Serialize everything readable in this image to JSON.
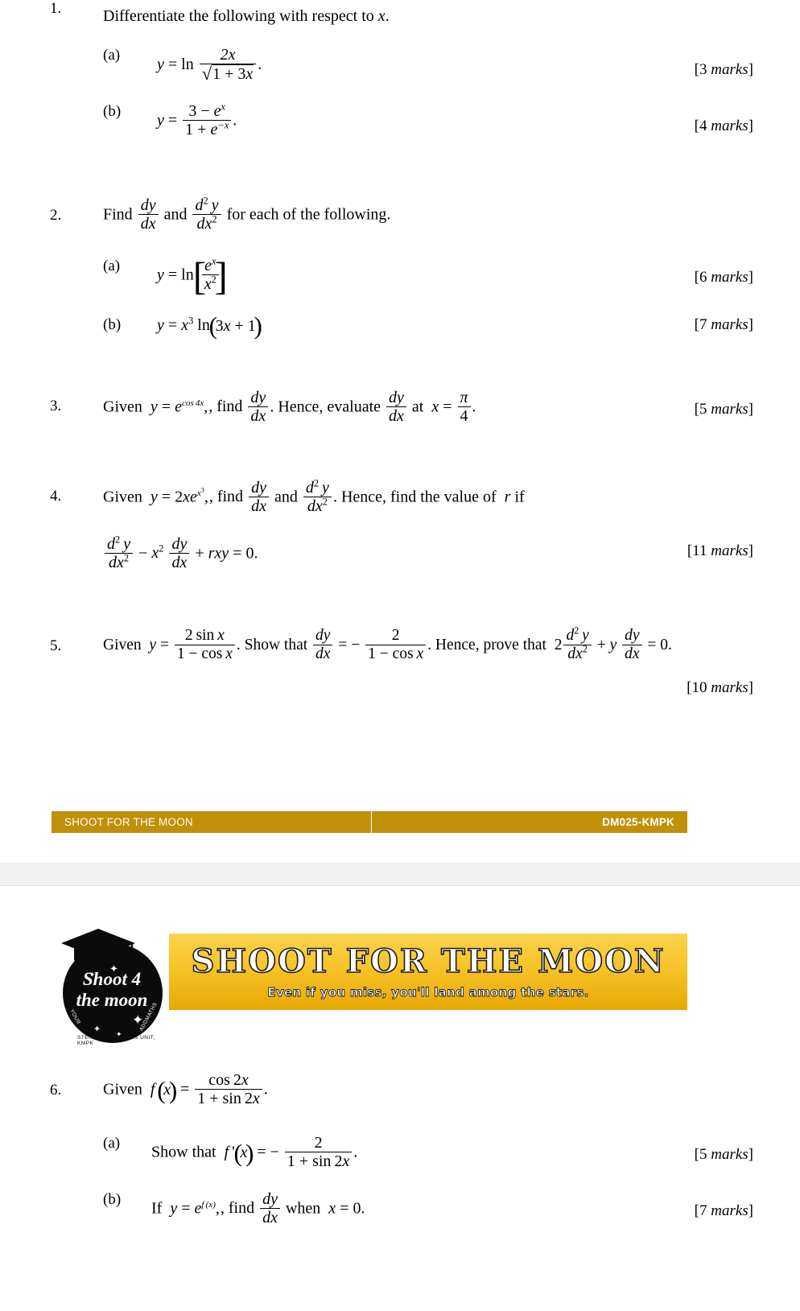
{
  "document": {
    "title": "SHOOT FOR THE MOON",
    "paper_code": "DM025-KMPK",
    "accent_color": "#c0900a",
    "banner_gradient_top": "#fbd24e",
    "banner_gradient_bottom": "#e6a804"
  },
  "questions": {
    "q1": {
      "number": "1.",
      "stem": "Differentiate the following with respect to",
      "stem_var": "x",
      "stem_end": ".",
      "a": {
        "label": "(a)",
        "lhs": "y",
        "eq": "=",
        "fn": "ln",
        "numerator": "2x",
        "denominator": "1 + 3x",
        "period": ".",
        "marks": "[3 marks]",
        "marks_count": "3",
        "marks_word": "marks"
      },
      "b": {
        "label": "(b)",
        "lhs": "y",
        "eq": "=",
        "numerator": "3 − e^x",
        "denominator": "1 + e^-x",
        "period": ".",
        "marks": "[4 marks]",
        "marks_count": "4",
        "marks_word": "marks"
      }
    },
    "q2": {
      "number": "2.",
      "stem_pre": "Find",
      "stem_mid": "and",
      "stem_post": "for each of the following.",
      "a": {
        "label": "(a)",
        "lhs": "y",
        "eq": "=",
        "fn": "ln",
        "numerator": "e^x",
        "denominator": "x^2",
        "marks": "[6 marks]",
        "marks_count": "6",
        "marks_word": "marks"
      },
      "b": {
        "label": "(b)",
        "expr": "y = x^3 ln(3x + 1)",
        "marks": "[7 marks]",
        "marks_count": "7",
        "marks_word": "marks"
      }
    },
    "q3": {
      "number": "3.",
      "given": "Given",
      "eqn": "y = e^(cos 4x)",
      "find": ", find",
      "hence": ". Hence, evaluate",
      "at": "at",
      "x_value_num": "π",
      "x_value_den": "4",
      "period": ".",
      "marks": "[5 marks]",
      "marks_count": "5",
      "marks_word": "marks"
    },
    "q4": {
      "number": "4.",
      "given": "Given",
      "eqn": "y = 2xe^(x^3)",
      "find": ", find",
      "and": "and",
      "hence": ". Hence, find the value of",
      "r_var": "r",
      "if": "if",
      "equation_tail": "= 0.",
      "marks": "[11 marks]",
      "marks_count": "11",
      "marks_word": "marks"
    },
    "q5": {
      "number": "5.",
      "given": "Given",
      "y_num": "2 sin x",
      "y_den": "1 − cos x",
      "show": ". Show that",
      "rhs_num": "2",
      "rhs_den": "1 − cos x",
      "hence": ". Hence, prove that",
      "tail": "= 0.",
      "marks": "[10 marks]",
      "marks_count": "10",
      "marks_word": "marks"
    },
    "q6": {
      "number": "6.",
      "given": "Given",
      "f_num": "cos 2x",
      "f_den": "1 + sin 2x",
      "period": ".",
      "a": {
        "label": "(a)",
        "text": "Show that",
        "rhs_num": "2",
        "rhs_den": "1 + sin 2x",
        "period": ".",
        "marks": "[5 marks]",
        "marks_count": "5",
        "marks_word": "marks"
      },
      "b": {
        "label": "(b)",
        "if": "If",
        "eqn": "y = e^f(x)",
        "find": ", find",
        "when": "when",
        "x_eq": "x = 0.",
        "marks": "[7 marks]",
        "marks_count": "7",
        "marks_word": "marks"
      }
    }
  },
  "footer": {
    "left_label": "SHOOT FOR THE MOON",
    "right_label": "DM025-KMPK"
  },
  "logo": {
    "line1": "Shoot 4",
    "line2": "the moon",
    "arc_left": "YOUR",
    "arc_right": "ADDMATHS",
    "arc_bottom": "STER, MATHEMATICS UNIT, KMPK"
  },
  "banner": {
    "title": "SHOOT FOR THE MOON",
    "tagline": "Even if you miss, you'll land among the stars."
  }
}
